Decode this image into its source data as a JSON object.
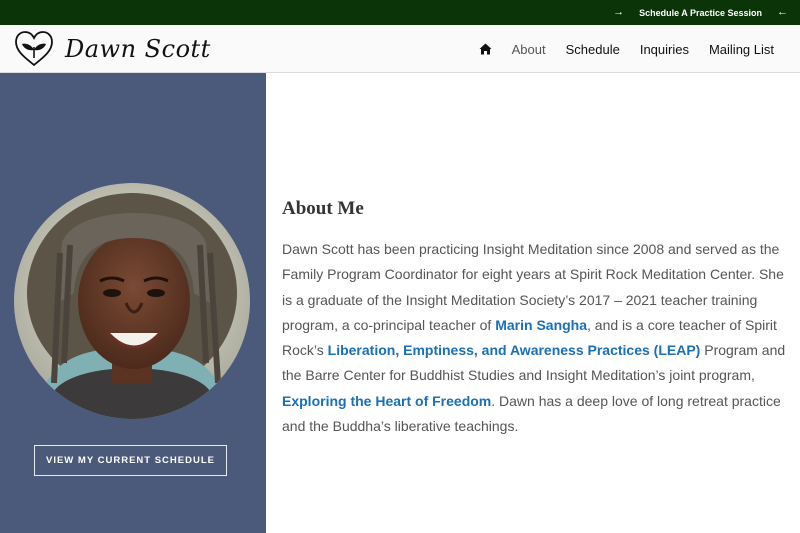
{
  "topbar": {
    "cta_label": "Schedule A Practice Session",
    "arrow_right_icon": "arrow-right-icon",
    "arrow_left_icon": "arrow-left-icon"
  },
  "header": {
    "logo_icon": "heart-sprout-icon",
    "logo_text": "Dawn Scott",
    "nav": {
      "home_icon": "home-icon",
      "items": [
        {
          "label": "About",
          "active": true
        },
        {
          "label": "Schedule"
        },
        {
          "label": "Inquiries"
        },
        {
          "label": "Mailing List"
        }
      ]
    }
  },
  "sidebar": {
    "portrait_alt": "",
    "button_label": "VIEW MY CURRENT SCHEDULE"
  },
  "content": {
    "title": "About Me",
    "p1": "Dawn Scott has been practicing Insight Meditation since 2008 and served as the Family Program Coordinator for eight years at Spirit Rock Meditation Center.  She is a graduate of the Insight Meditation Society’s 2017 – 2021 teacher training program, a co-principal teacher of ",
    "link1": "Marin Sangha",
    "p2": ", and is a core teacher of Spirit Rock’s ",
    "link2": "Liberation, Emptiness, and Awareness Practices (LEAP)",
    "p3": " Program and the Barre Center for Buddhist Studies and Insight Meditation’s joint program, ",
    "link3": "Exploring the Heart of Freedom",
    "p4": ". Dawn has a deep love of long retreat practice and the Buddha’s liberative teachings."
  },
  "colors": {
    "topbar_bg": "#0b3509",
    "sidebar_bg": "#4b5a7b",
    "link": "#1a6fb5"
  }
}
